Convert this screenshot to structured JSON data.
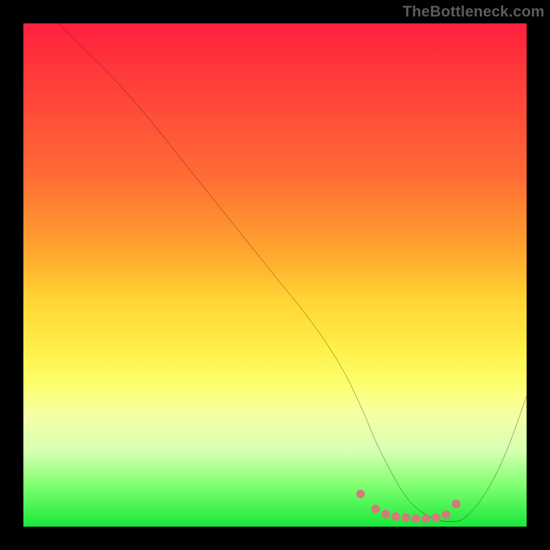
{
  "watermark": "TheBottleneck.com",
  "colors": {
    "frame": "#000000",
    "watermark_text": "#5c5c5c",
    "curve_stroke": "#000000",
    "dot_fill": "#d47a7a",
    "gradient_stops": [
      "#ff1f3e",
      "#ff3a3a",
      "#ff6b35",
      "#ffa42e",
      "#ffd534",
      "#fff04a",
      "#fdff70",
      "#f5ffa6",
      "#d7ffb2",
      "#7cff6e",
      "#19e83a"
    ]
  },
  "chart_data": {
    "type": "line",
    "title": "",
    "xlabel": "",
    "ylabel": "",
    "xlim": [
      0,
      100
    ],
    "ylim": [
      0,
      100
    ],
    "series": [
      {
        "name": "curve",
        "x": [
          7,
          12,
          18,
          25,
          33,
          41,
          49,
          57,
          63,
          67,
          70,
          73,
          76,
          79,
          82,
          85,
          88,
          92,
          96,
          100
        ],
        "y": [
          100,
          95,
          89,
          81,
          71,
          61,
          51,
          41,
          32,
          24,
          17,
          11,
          6,
          3,
          1.5,
          1,
          2,
          7,
          15,
          26
        ]
      }
    ],
    "highlight_dots": {
      "name": "dots",
      "x": [
        67,
        70,
        72,
        74,
        76,
        78,
        80,
        82,
        84,
        86
      ],
      "y": [
        6.5,
        3.5,
        2.5,
        2,
        1.8,
        1.6,
        1.6,
        1.8,
        2.4,
        4.5
      ]
    }
  }
}
